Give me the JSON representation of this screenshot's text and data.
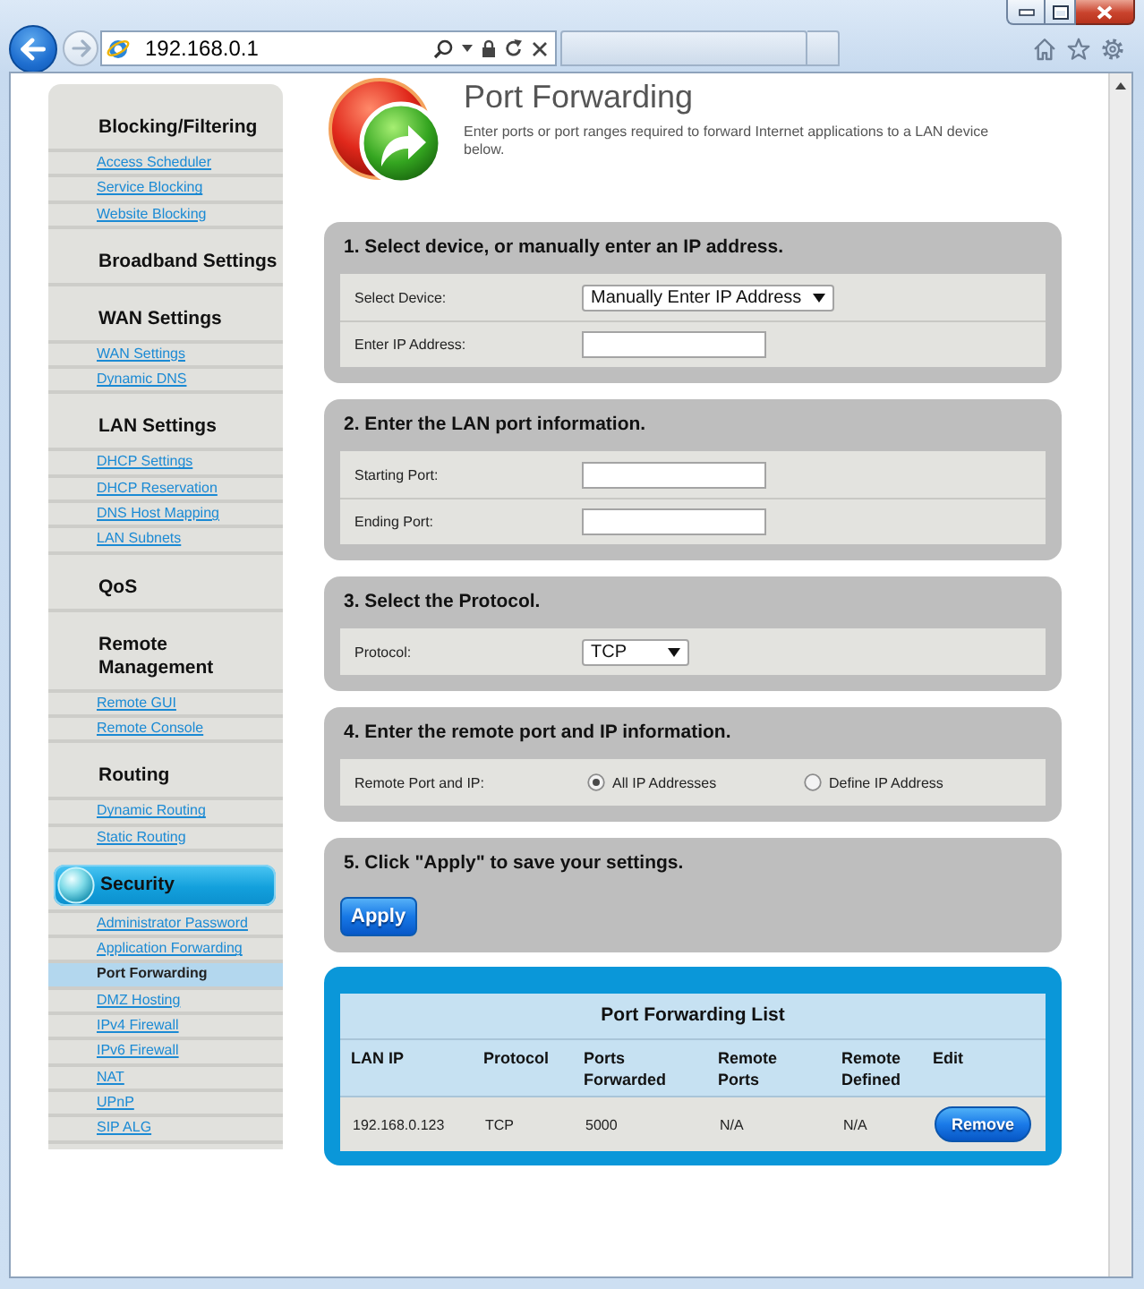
{
  "browser": {
    "address": "192.168.0.1"
  },
  "sidebar": {
    "sections": [
      {
        "title": "Blocking/Filtering",
        "selected": false,
        "items": [
          {
            "label": "Access Scheduler",
            "selected": false
          },
          {
            "label": "Service Blocking",
            "selected": false
          },
          {
            "label": "Website Blocking",
            "selected": false
          }
        ]
      },
      {
        "title": "Broadband Settings",
        "selected": false
      },
      {
        "title": "WAN Settings",
        "selected": false,
        "items": [
          {
            "label": "WAN Settings",
            "selected": false
          },
          {
            "label": "Dynamic DNS",
            "selected": false
          }
        ]
      },
      {
        "title": "LAN Settings",
        "selected": false,
        "items": [
          {
            "label": "DHCP Settings",
            "selected": false
          },
          {
            "label": "DHCP Reservation",
            "selected": false
          },
          {
            "label": "DNS Host Mapping",
            "selected": false
          },
          {
            "label": "LAN Subnets",
            "selected": false
          }
        ]
      },
      {
        "title": "QoS",
        "selected": false
      },
      {
        "title": "Remote Management",
        "selected": false,
        "items": [
          {
            "label": "Remote GUI",
            "selected": false
          },
          {
            "label": "Remote Console",
            "selected": false
          }
        ]
      },
      {
        "title": "Routing",
        "selected": false,
        "items": [
          {
            "label": "Dynamic Routing",
            "selected": false
          },
          {
            "label": "Static Routing",
            "selected": false
          }
        ]
      },
      {
        "title": "Security",
        "selected": true,
        "items": [
          {
            "label": "Administrator Password",
            "selected": false
          },
          {
            "label": "Application Forwarding",
            "selected": false
          },
          {
            "label": "Port Forwarding",
            "selected": true
          },
          {
            "label": "DMZ Hosting",
            "selected": false
          },
          {
            "label": "IPv4 Firewall",
            "selected": false
          },
          {
            "label": "IPv6 Firewall",
            "selected": false
          },
          {
            "label": "NAT",
            "selected": false
          },
          {
            "label": "UPnP",
            "selected": false
          },
          {
            "label": "SIP ALG",
            "selected": false
          }
        ]
      }
    ]
  },
  "page": {
    "title": "Port Forwarding",
    "description": "Enter ports or port ranges required to forward Internet applications to a LAN device below."
  },
  "steps": [
    {
      "heading": "1. Select device, or manually enter an IP address.",
      "fields": [
        {
          "kind": "select",
          "label": "Select Device:",
          "value": "Manually Enter IP Address"
        },
        {
          "kind": "input",
          "label": "Enter IP Address:"
        }
      ]
    },
    {
      "heading": "2. Enter the LAN port information.",
      "fields": [
        {
          "kind": "input",
          "label": "Starting Port:"
        },
        {
          "kind": "input",
          "label": "Ending Port:"
        }
      ]
    },
    {
      "heading": "3. Select the Protocol.",
      "fields": [
        {
          "kind": "select",
          "label": "Protocol:",
          "value": "TCP"
        }
      ]
    },
    {
      "heading": "4. Enter the remote port and IP information.",
      "fields": [
        {
          "kind": "radio",
          "label": "Remote Port and IP:",
          "options": [
            {
              "label": "All IP Addresses",
              "selected": true
            },
            {
              "label": "Define IP Address",
              "selected": false
            }
          ]
        }
      ]
    },
    {
      "heading": "5. Click \"Apply\" to save your settings.",
      "button": "Apply"
    }
  ],
  "forwarding_list": {
    "title": "Port Forwarding List",
    "columns": [
      "LAN IP",
      "Protocol",
      "Ports Forwarded",
      "Remote Ports",
      "Remote Defined",
      "Edit"
    ],
    "rows": [
      {
        "cells": [
          "192.168.0.123",
          "TCP",
          "5000",
          "N/A",
          "N/A"
        ],
        "action": "Remove"
      }
    ]
  }
}
